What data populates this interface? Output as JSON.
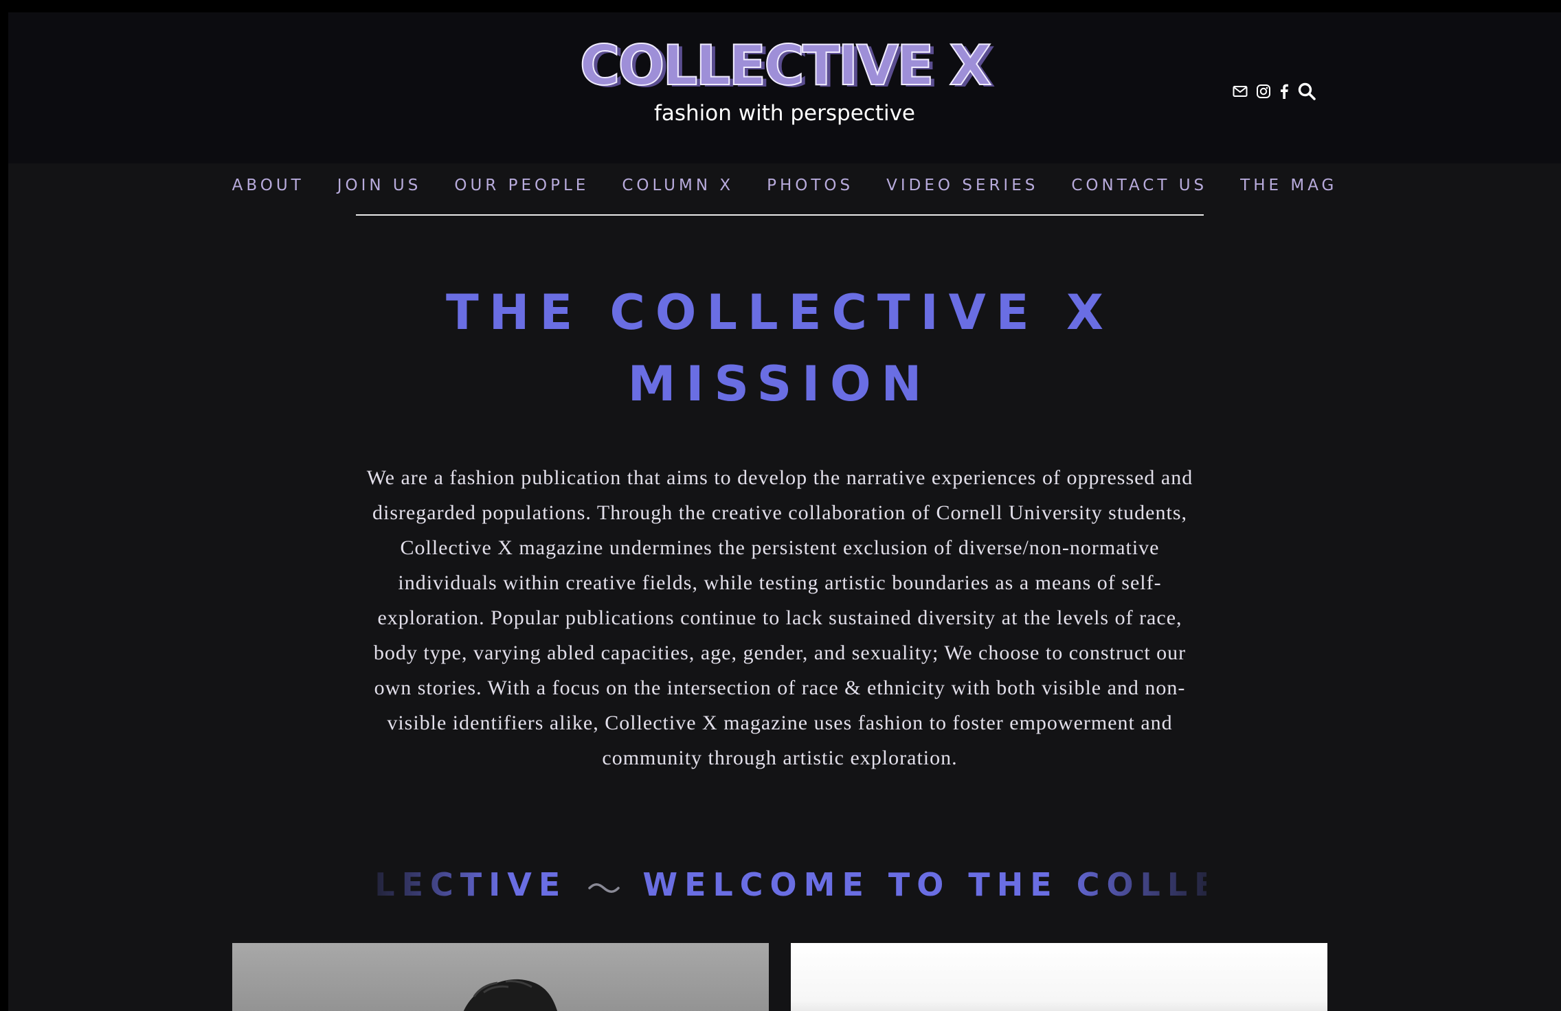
{
  "header": {
    "logo": "COLLECTIVE X",
    "tagline": "fashion with perspective",
    "social_icons": [
      "mail-icon",
      "instagram-icon",
      "facebook-icon",
      "search-icon"
    ]
  },
  "nav": {
    "items": [
      {
        "label": "ABOUT"
      },
      {
        "label": "JOIN US"
      },
      {
        "label": "OUR PEOPLE"
      },
      {
        "label": "COLUMN X"
      },
      {
        "label": "PHOTOS"
      },
      {
        "label": "VIDEO SERIES"
      },
      {
        "label": "CONTACT US"
      },
      {
        "label": "THE MAG"
      }
    ]
  },
  "mission": {
    "title_line1": "THE COLLECTIVE X",
    "title_line2": "MISSION",
    "body": "We are a fashion publication that aims to develop the narrative experiences of oppressed and disregarded populations. Through the creative collaboration of Cornell University students, Collective X magazine undermines the persistent exclusion of diverse/non-normative individuals within creative fields, while testing artistic boundaries as a means of self-exploration. Popular publications continue to lack sustained diversity at the levels of race, body type, varying abled capacities, age, gender, and sexuality; We choose to construct our own stories.  With a focus on the intersection of race & ethnicity with both visible and non-visible identifiers alike, Collective X magazine uses fashion to foster empowerment and community through artistic exploration."
  },
  "marquee": {
    "text_left": "LLECTIVE",
    "text_right": "WELCOME TO THE COLLECTI"
  },
  "colors": {
    "page_bg": "#131315",
    "header_bg": "#0c0c10",
    "accent": "#6a6ee3",
    "nav_text": "#b8abdc",
    "logo_fill": "#9e8fd8",
    "body_text": "#e2dfea"
  }
}
